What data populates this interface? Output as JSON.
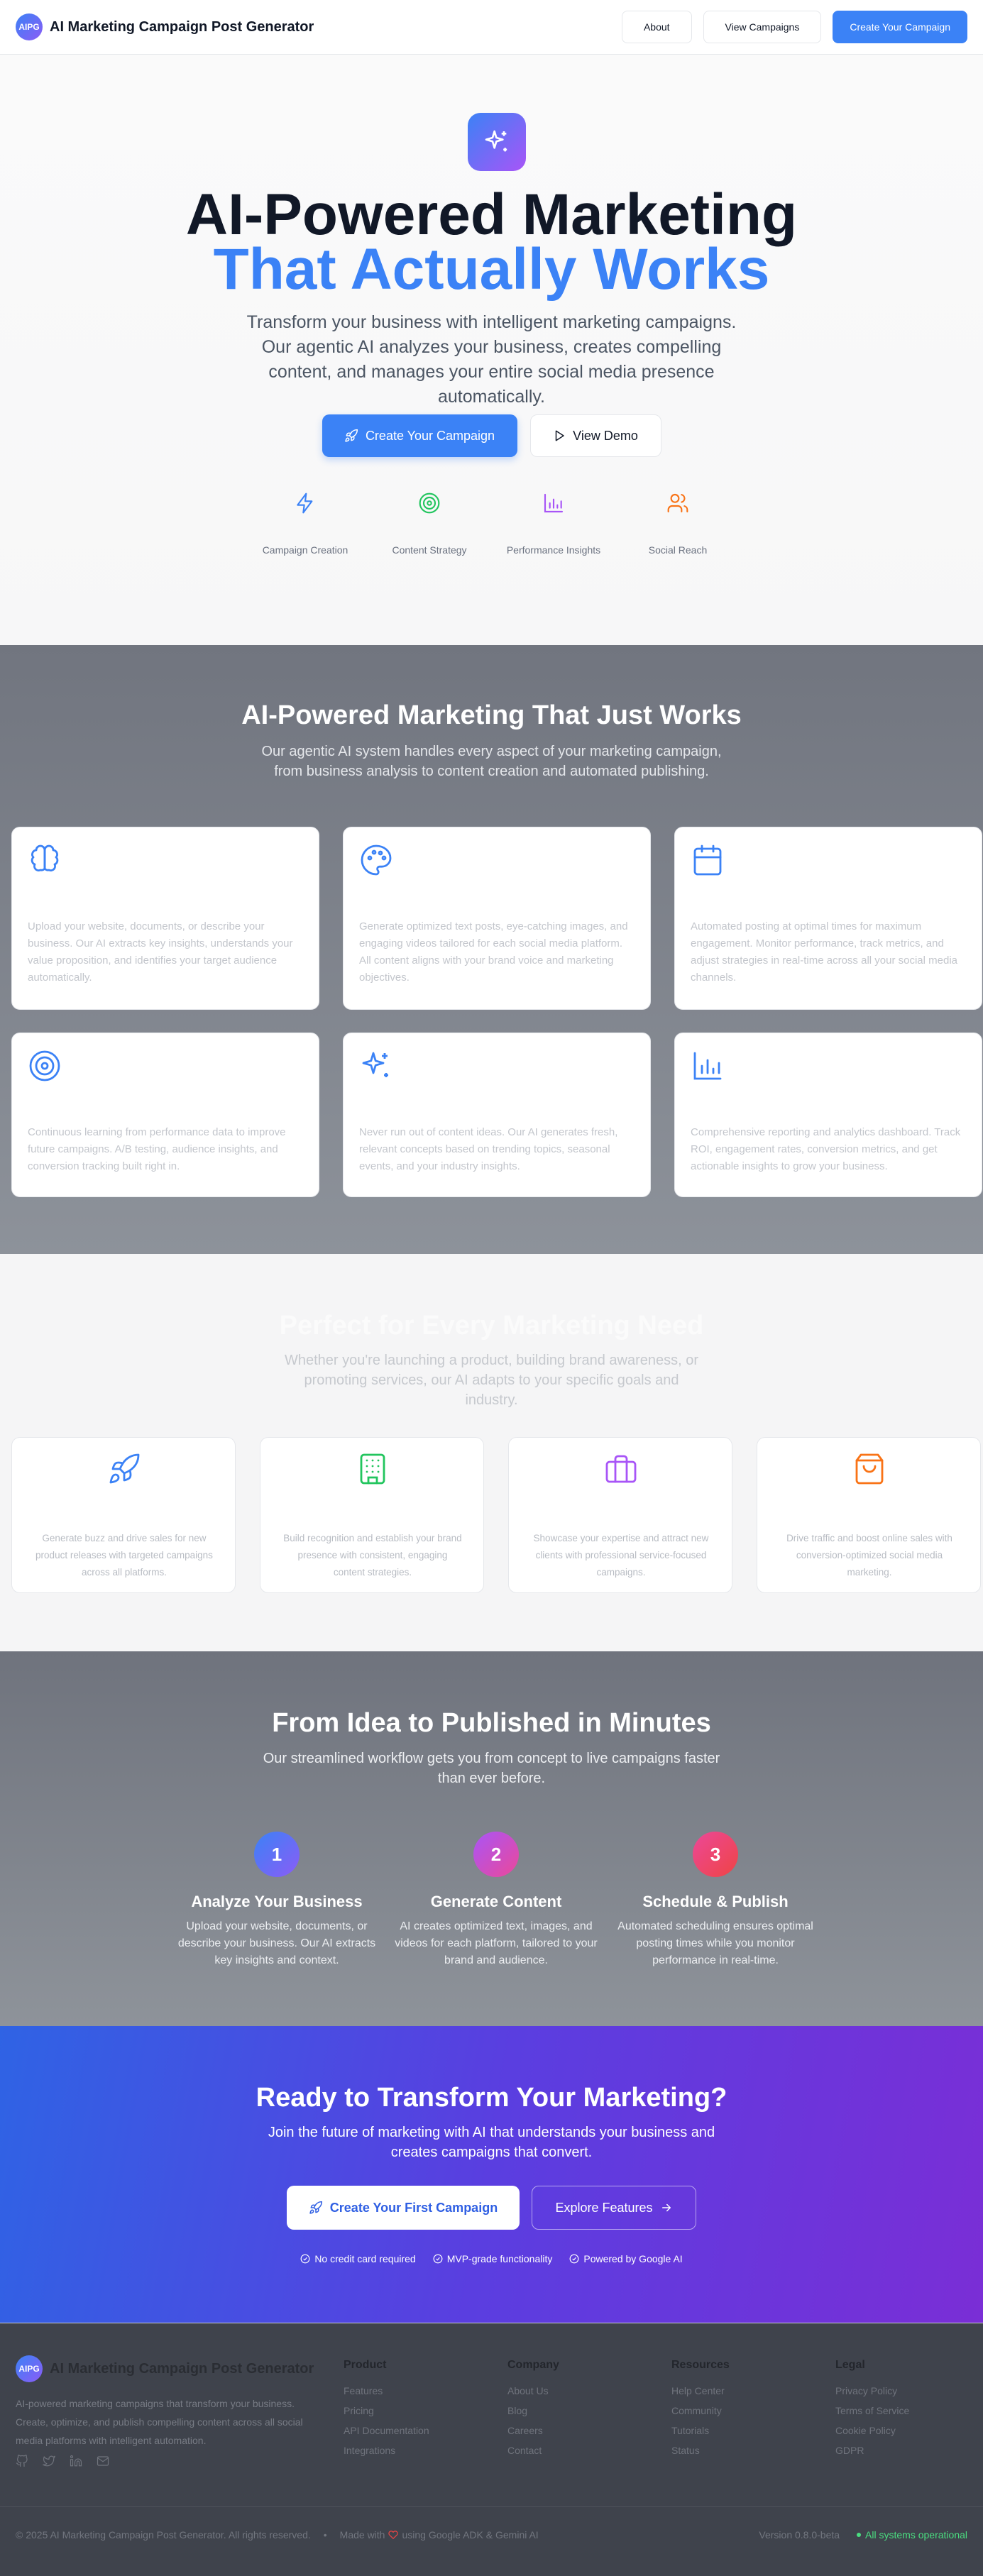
{
  "nav": {
    "logo": "AIPG",
    "title": "AI Marketing Campaign Post Generator",
    "about": "About",
    "view_campaigns": "View Campaigns",
    "create_campaign": "Create Your Campaign"
  },
  "hero": {
    "title_line1": "AI-Powered Marketing",
    "title_line2": "That Actually Works",
    "subtitle": "Transform your business with intelligent marketing campaigns. Our agentic AI analyzes your business, creates compelling content, and manages your entire social media presence automatically.",
    "primary_button": "Create Your Campaign",
    "secondary_button": "View Demo",
    "features": [
      {
        "icon": "zap-icon",
        "color": "#3b82f6",
        "label": "Campaign Creation"
      },
      {
        "icon": "target-icon",
        "color": "#22c55e",
        "label": "Content Strategy"
      },
      {
        "icon": "bar-chart-icon",
        "color": "#a855f7",
        "label": "Performance Insights"
      },
      {
        "icon": "users-icon",
        "color": "#f97316",
        "label": "Social Reach"
      }
    ]
  },
  "features": {
    "title": "AI-Powered Marketing That Just Works",
    "subtitle": "Our agentic AI system handles every aspect of your marketing campaign, from business analysis to content creation and automated publishing.",
    "cards": [
      {
        "icon": "brain-icon",
        "desc": "Upload your website, documents, or describe your business. Our AI extracts key insights, understands your value proposition, and identifies your target audience automatically."
      },
      {
        "icon": "palette-icon",
        "desc": "Generate optimized text posts, eye-catching images, and engaging videos tailored for each social media platform. All content aligns with your brand voice and marketing objectives."
      },
      {
        "icon": "calendar-icon",
        "desc": "Automated posting at optimal times for maximum engagement. Monitor performance, track metrics, and adjust strategies in real-time across all your social media channels."
      },
      {
        "icon": "target-icon",
        "desc": "Continuous learning from performance data to improve future campaigns. A/B testing, audience insights, and conversion tracking built right in."
      },
      {
        "icon": "sparkles-icon",
        "desc": "Never run out of content ideas. Our AI generates fresh, relevant concepts based on trending topics, seasonal events, and your industry insights."
      },
      {
        "icon": "bar-chart-icon",
        "desc": "Comprehensive reporting and analytics dashboard. Track ROI, engagement rates, conversion metrics, and get actionable insights to grow your business."
      }
    ]
  },
  "usecases": {
    "title": "Perfect for Every Marketing Need",
    "subtitle": "Whether you're launching a product, building brand awareness, or promoting services, our AI adapts to your specific goals and industry.",
    "cards": [
      {
        "icon": "rocket-icon",
        "color": "#3b82f6",
        "desc": "Generate buzz and drive sales for new product releases with targeted campaigns across all platforms."
      },
      {
        "icon": "building-icon",
        "color": "#22c55e",
        "desc": "Build recognition and establish your brand presence with consistent, engaging content strategies."
      },
      {
        "icon": "briefcase-icon",
        "color": "#a855f7",
        "desc": "Showcase your expertise and attract new clients with professional service-focused campaigns."
      },
      {
        "icon": "shopping-bag-icon",
        "color": "#f97316",
        "desc": "Drive traffic and boost online sales with conversion-optimized social media marketing."
      }
    ]
  },
  "workflow": {
    "title": "From Idea to Published in Minutes",
    "subtitle": "Our streamlined workflow gets you from concept to live campaigns faster than ever before.",
    "steps": [
      {
        "num": "1",
        "title": "Analyze Your Business",
        "desc": "Upload your website, documents, or describe your business. Our AI extracts key insights and context."
      },
      {
        "num": "2",
        "title": "Generate Content",
        "desc": "AI creates optimized text, images, and videos for each platform, tailored to your brand and audience."
      },
      {
        "num": "3",
        "title": "Schedule & Publish",
        "desc": "Automated scheduling ensures optimal posting times while you monitor performance in real-time."
      }
    ]
  },
  "cta": {
    "title": "Ready to Transform Your Marketing?",
    "subtitle": "Join the future of marketing with AI that understands your business and creates campaigns that convert.",
    "primary": "Create Your First Campaign",
    "secondary": "Explore Features",
    "checks": [
      "No credit card required",
      "MVP-grade functionality",
      "Powered by Google AI"
    ]
  },
  "footer": {
    "brand": "AI Marketing Campaign Post Generator",
    "desc": "AI-powered marketing campaigns that transform your business. Create, optimize, and publish compelling content across all social media platforms with intelligent automation.",
    "columns": [
      {
        "heading": "Product",
        "links": [
          "Features",
          "Pricing",
          "API Documentation",
          "Integrations"
        ]
      },
      {
        "heading": "Company",
        "links": [
          "About Us",
          "Blog",
          "Careers",
          "Contact"
        ]
      },
      {
        "heading": "Resources",
        "links": [
          "Help Center",
          "Community",
          "Tutorials",
          "Status"
        ]
      },
      {
        "heading": "Legal",
        "links": [
          "Privacy Policy",
          "Terms of Service",
          "Cookie Policy",
          "GDPR"
        ]
      }
    ],
    "copyright": "© 2025 AI Marketing Campaign Post Generator. All rights reserved.",
    "made_with_prefix": "Made with",
    "made_with_suffix": "using Google ADK & Gemini AI",
    "version": "Version 0.8.0-beta",
    "status": "All systems operational"
  }
}
